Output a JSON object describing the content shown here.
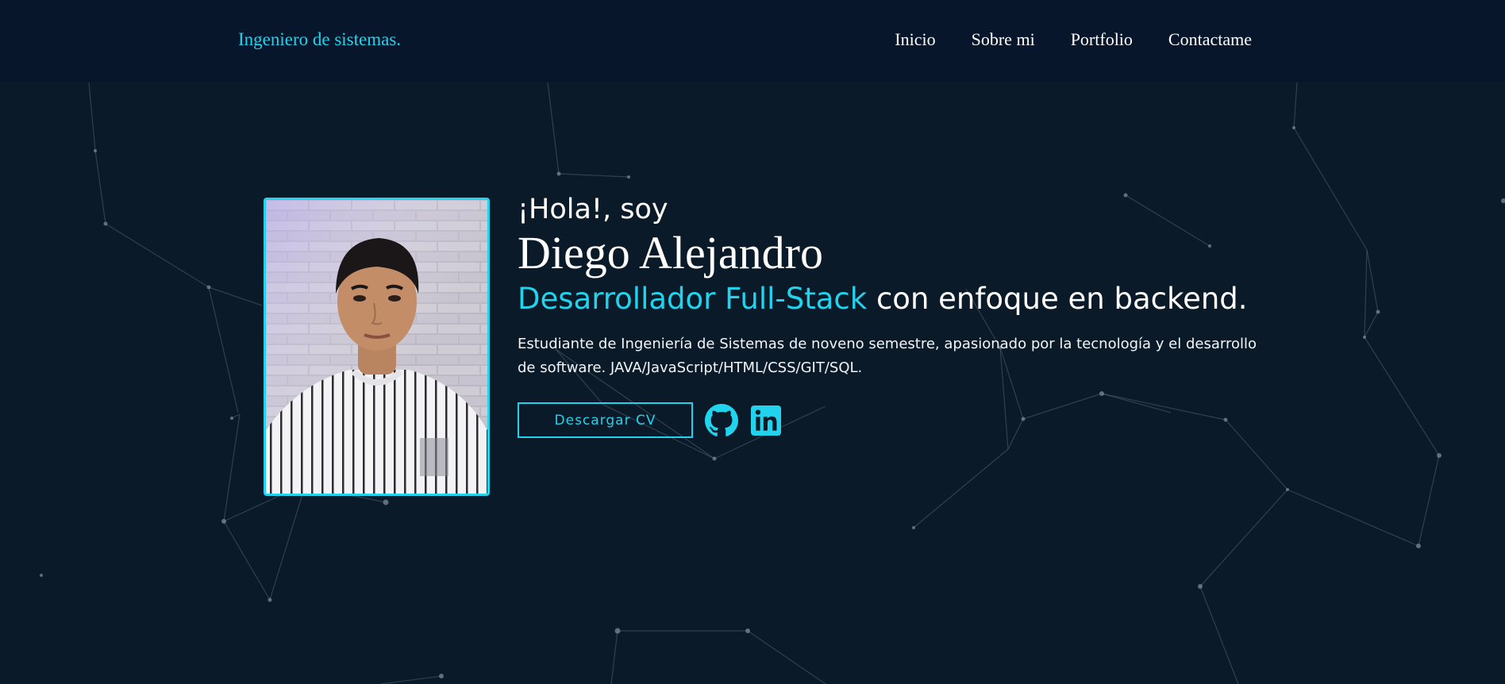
{
  "navbar": {
    "brand": "Ingeniero de sistemas.",
    "links": [
      "Inicio",
      "Sobre mi",
      "Portfolio",
      "Contactame"
    ]
  },
  "hero": {
    "greeting": "¡Hola!, soy",
    "name": "Diego Alejandro",
    "role_highlight": "Desarrollador Full-Stack",
    "role_rest": " con enfoque en backend.",
    "bio": "Estudiante de Ingeniería de Sistemas de noveno semestre, apasionado por la tecnología y el desarrollo de software. JAVA/JavaScript/HTML/CSS/GIT/SQL.",
    "cv_button": "Descargar CV",
    "social_icons": [
      "github-icon",
      "linkedin-icon"
    ]
  },
  "colors": {
    "background": "#0a1a28",
    "navbar": "#07162a",
    "accent": "#22d3ee",
    "text": "#ffffff"
  }
}
